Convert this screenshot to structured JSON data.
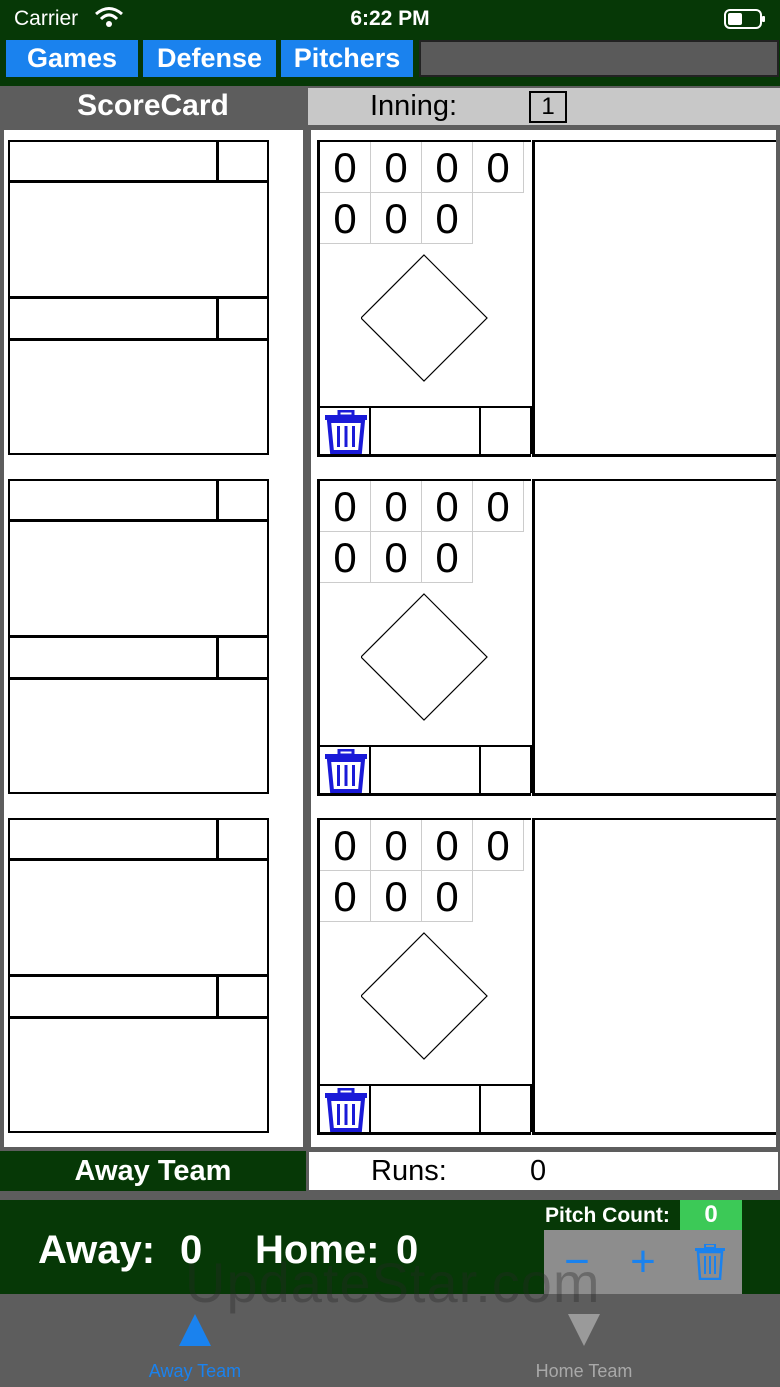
{
  "status_bar": {
    "carrier": "Carrier",
    "time": "6:22 PM"
  },
  "nav": {
    "games": "Games",
    "defense": "Defense",
    "pitchers": "Pitchers"
  },
  "header": {
    "title": "ScoreCard",
    "inning_label": "Inning:",
    "inning_value": "1"
  },
  "at_bats": [
    {
      "counts_row1": [
        "0",
        "0",
        "0",
        "0"
      ],
      "counts_row2": [
        "0",
        "0",
        "0"
      ]
    },
    {
      "counts_row1": [
        "0",
        "0",
        "0",
        "0"
      ],
      "counts_row2": [
        "0",
        "0",
        "0"
      ]
    },
    {
      "counts_row1": [
        "0",
        "0",
        "0",
        "0"
      ],
      "counts_row2": [
        "0",
        "0",
        "0"
      ]
    }
  ],
  "team_bar": {
    "team": "Away Team",
    "runs_label": "Runs:",
    "runs_value": "0"
  },
  "scoreboard": {
    "away_label": "Away:",
    "away_score": "0",
    "home_label": "Home:",
    "home_score": "0",
    "pitch_count_label": "Pitch Count:",
    "pitch_count_value": "0",
    "minus": "−",
    "plus": "+"
  },
  "watermark": "UpdateStar.com",
  "tabs": [
    {
      "label": "Away Team",
      "icon": "triangle-up-icon",
      "active": true
    },
    {
      "label": "Home Team",
      "icon": "triangle-down-icon",
      "active": false
    }
  ],
  "colors": {
    "dark_green": "#063806",
    "blue": "#1a82ee",
    "green": "#3cc957",
    "gray": "#5d5d5d"
  }
}
